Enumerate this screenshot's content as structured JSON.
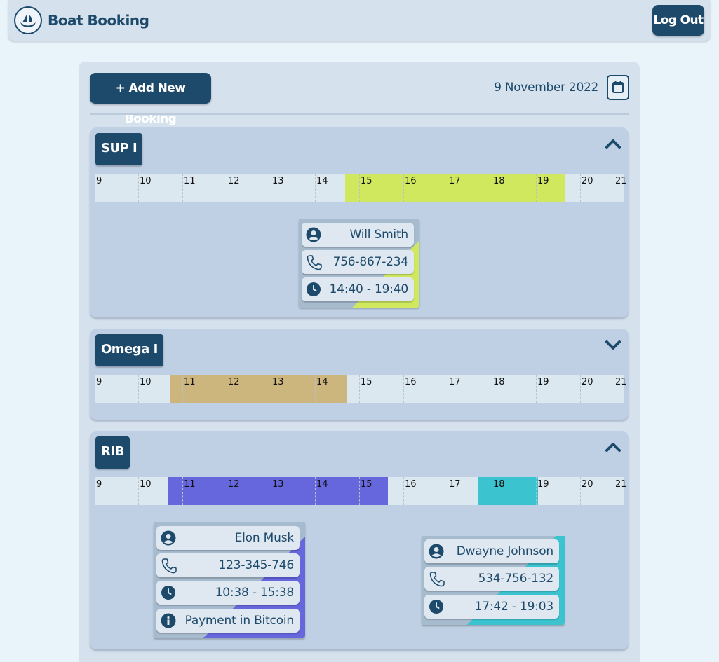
{
  "header": {
    "brand": "Boat Booking",
    "logout_label": "Log Out"
  },
  "toolbar": {
    "add_label": "+ Add New Booking",
    "date": "9 November 2022"
  },
  "hours": [
    "9",
    "10",
    "11",
    "12",
    "13",
    "14",
    "15",
    "16",
    "17",
    "18",
    "19",
    "20",
    "21"
  ],
  "boats": [
    {
      "name": "SUP I",
      "expanded": true,
      "bookings": [
        {
          "name": "Will Smith",
          "phone": "756-867-234",
          "time": "14:40 - 19:40",
          "color": "#cfe85e"
        }
      ]
    },
    {
      "name": "Omega I",
      "expanded": false,
      "bookings": [
        {
          "time_range": "10:38 - 14:40",
          "color": "#ccb67d"
        }
      ]
    },
    {
      "name": "RIB",
      "expanded": true,
      "bookings": [
        {
          "name": "Elon Musk",
          "phone": "123-345-746",
          "time": "10:38 - 15:38",
          "note": "Payment in Bitcoin",
          "color": "#6666dd"
        },
        {
          "name": "Dwayne Johnson",
          "phone": "534-756-132",
          "time": "17:42 - 19:03",
          "color": "#3bc3cf"
        }
      ]
    }
  ]
}
